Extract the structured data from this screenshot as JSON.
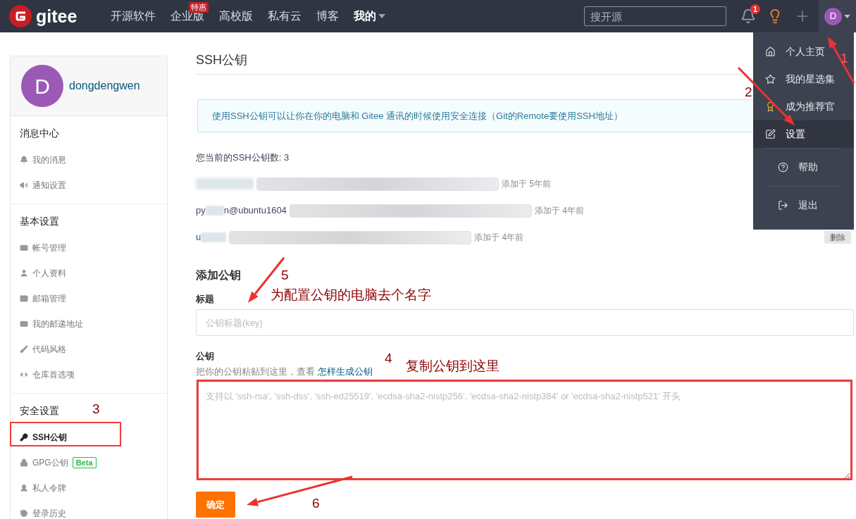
{
  "header": {
    "brand": "gitee",
    "nav": [
      {
        "label": "开源软件",
        "caret": false,
        "selected": false
      },
      {
        "label": "企业版",
        "badge": "特惠",
        "caret": false,
        "selected": false
      },
      {
        "label": "高校版",
        "caret": false,
        "selected": false
      },
      {
        "label": "私有云",
        "caret": false,
        "selected": false
      },
      {
        "label": "博客",
        "caret": false,
        "selected": false
      },
      {
        "label": "我的",
        "caret": true,
        "selected": true
      }
    ],
    "search": {
      "placeholder": "搜开源"
    },
    "notification_count": "1",
    "avatar": "D",
    "menu_open": true
  },
  "sidebar": {
    "avatar": "D",
    "username": "dongdengwen",
    "sections": [
      {
        "title": "消息中心",
        "items": [
          {
            "label": "我的消息",
            "selected": false
          },
          {
            "label": "通知设置",
            "selected": false
          }
        ]
      },
      {
        "title": "基本设置",
        "items": [
          {
            "label": "帐号管理",
            "selected": false
          },
          {
            "label": "个人资料",
            "selected": false
          },
          {
            "label": "邮箱管理",
            "selected": false
          },
          {
            "label": "我的邮递地址",
            "selected": false
          },
          {
            "label": "代码风格",
            "selected": false
          },
          {
            "label": "仓库首选项",
            "selected": false
          }
        ]
      },
      {
        "title": "安全设置",
        "items": [
          {
            "label": "SSH公钥",
            "selected": true
          },
          {
            "label": "GPG公钥",
            "badge": "Beta",
            "selected": false
          },
          {
            "label": "私人令牌",
            "selected": false
          },
          {
            "label": "登录历史",
            "selected": false
          }
        ]
      }
    ]
  },
  "main": {
    "title": "SSH公钥",
    "info": "使用SSH公钥可以让你在你的电脑和 Gitee 通讯的时候使用安全连接（Git的Remote要使用SSH地址）",
    "key_count": "您当前的SSH公钥数: 3",
    "keys": [
      {
        "added": "添加于 5年前"
      },
      {
        "owner_parts": [
          "py",
          "n@ubuntu1604"
        ],
        "added": "添加于 4年前"
      },
      {
        "owner_parts": [
          "u"
        ],
        "added": "添加于 4年前",
        "delete": "删除"
      }
    ],
    "add_title": "添加公钥",
    "title_label": "标题",
    "title_placeholder": "公钥标题(key)",
    "key_label": "公钥",
    "key_hint": "把你的公钥粘贴到这里，查看 ",
    "key_hint_link": "怎样生成公钥",
    "key_placeholder": "支持以 'ssh-rsa', 'ssh-dss', 'ssh-ed25519', 'ecdsa-sha2-nistp256', 'ecdsa-sha2-nistp384' or 'ecdsa-sha2-nistp521' 开头",
    "submit": "确定"
  },
  "user_menu": {
    "groups": [
      [
        {
          "label": "个人主页",
          "selected": false
        },
        {
          "label": "我的星选集",
          "selected": false
        },
        {
          "label": "成为推荐官",
          "selected": false
        },
        {
          "label": "设置",
          "selected": true
        }
      ],
      [
        {
          "label": "帮助",
          "selected": false
        }
      ],
      [
        {
          "label": "退出",
          "selected": false
        }
      ]
    ]
  },
  "annotations": {
    "steps": [
      "1",
      "2",
      "3",
      "4",
      "5",
      "6"
    ],
    "notes": [
      "为配置公钥的电脑去个名字",
      "复制公钥到这里"
    ]
  }
}
